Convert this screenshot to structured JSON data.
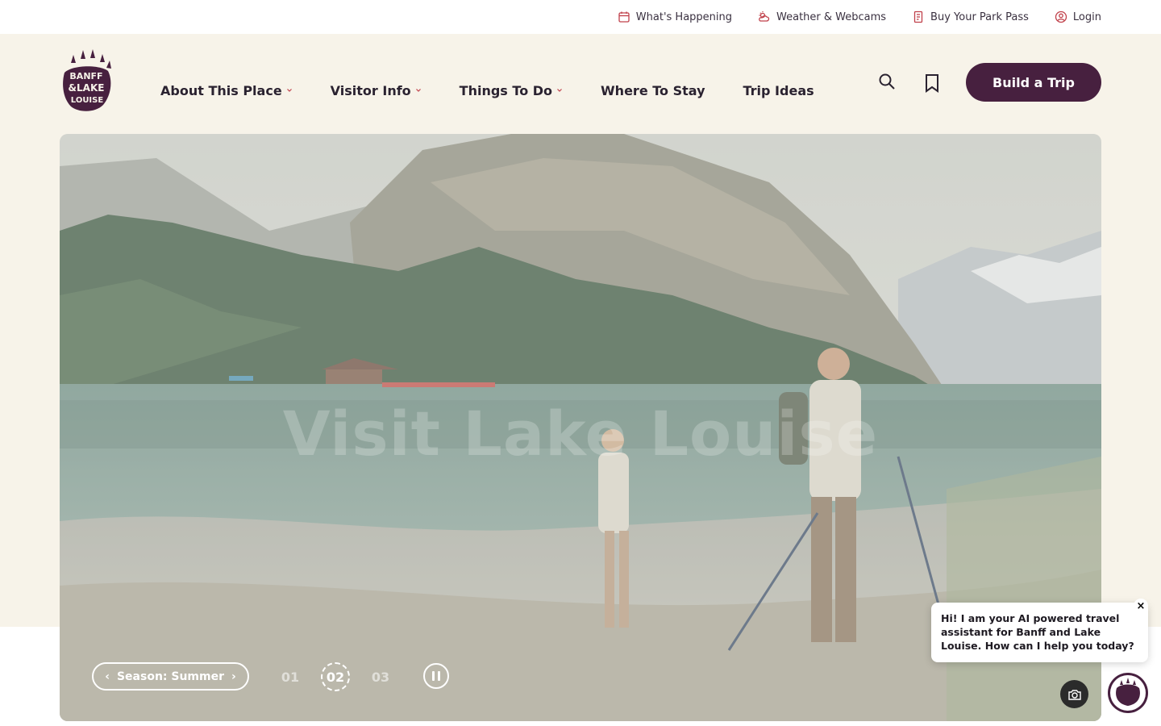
{
  "utility": {
    "items": [
      {
        "label": "What's Happening",
        "icon": "calendar-icon"
      },
      {
        "label": "Weather & Webcams",
        "icon": "weather-icon"
      },
      {
        "label": "Buy Your Park Pass",
        "icon": "park-pass-icon"
      },
      {
        "label": "Login",
        "icon": "user-icon"
      }
    ]
  },
  "brand": {
    "logo_text": [
      "BANFF",
      "&LAKE",
      "LOUISE"
    ],
    "primary_color": "#47203f",
    "background_color": "#f7f3e9"
  },
  "nav": {
    "items": [
      {
        "label": "About This Place",
        "has_dropdown": true
      },
      {
        "label": "Visitor Info",
        "has_dropdown": true
      },
      {
        "label": "Things To Do",
        "has_dropdown": true
      },
      {
        "label": "Where To Stay",
        "has_dropdown": false
      },
      {
        "label": "Trip Ideas",
        "has_dropdown": false
      }
    ],
    "cta_label": "Build a Trip"
  },
  "hero": {
    "title": "Visit Lake Louise",
    "season_label": "Season: Summer",
    "slides": [
      "01",
      "02",
      "03"
    ],
    "active_slide": "02"
  },
  "chat": {
    "message": "Hi! I am your AI powered travel assistant for Banff and Lake Louise. How can I help you today?",
    "close_label": "×"
  }
}
